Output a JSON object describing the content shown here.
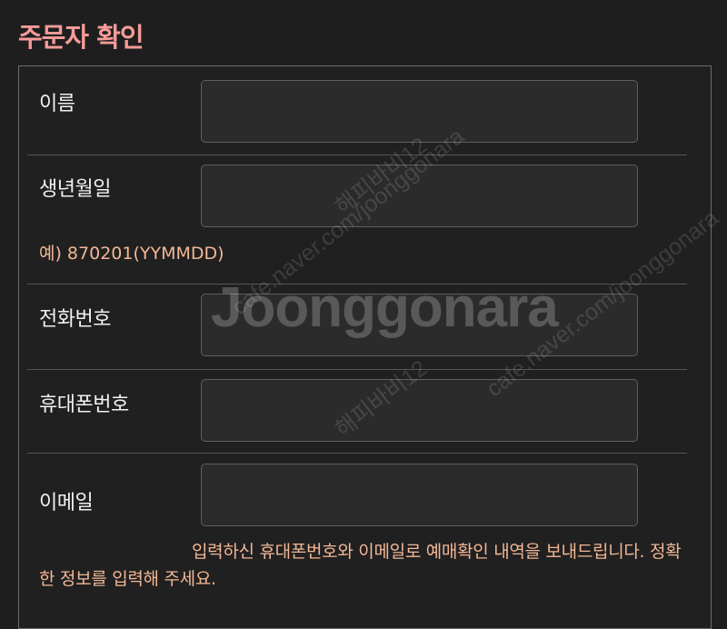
{
  "page_title": "주문자 확인",
  "form": {
    "name_label": "이름",
    "name_value": "",
    "birth_label": "생년월일",
    "birth_value": "",
    "birth_hint": "예) 870201(YYMMDD)",
    "phone_label": "전화번호",
    "phone_value": "",
    "mobile_label": "휴대폰번호",
    "mobile_value": "",
    "email_label": "이메일",
    "email_value": "",
    "notice": "입력하신 휴대폰번호와 이메일로 예매확인 내역을 보내드립니다. 정확한 정보를 입력해 주세요."
  },
  "watermark": {
    "logo": "Joonggonara",
    "url": "cafe.naver.com/joonggonara",
    "user": "해피바비12"
  }
}
